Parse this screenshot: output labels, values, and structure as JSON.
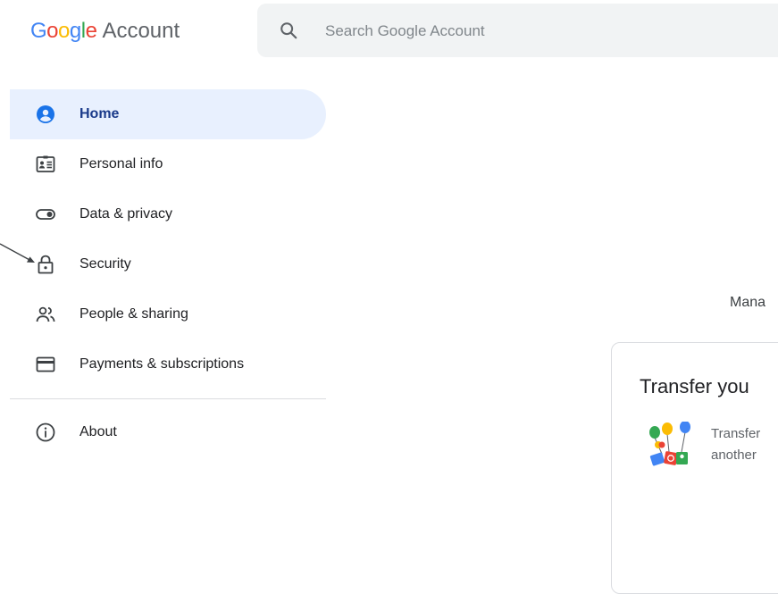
{
  "header": {
    "logo_letters": [
      "G",
      "o",
      "o",
      "g",
      "l",
      "e"
    ],
    "logo_colors": [
      "#4285F4",
      "#EA4335",
      "#FBBC05",
      "#4285F4",
      "#34A853",
      "#EA4335"
    ],
    "product": "Account",
    "search_placeholder": "Search Google Account",
    "search_icon": "search-icon"
  },
  "nav": {
    "active_color": "#e8f0fe",
    "items": [
      {
        "label": "Home",
        "icon": "account-circle-icon",
        "active": true
      },
      {
        "label": "Personal info",
        "icon": "id-card-icon"
      },
      {
        "label": "Data & privacy",
        "icon": "toggle-icon"
      },
      {
        "label": "Security",
        "icon": "lock-icon"
      },
      {
        "label": "People & sharing",
        "icon": "people-icon"
      },
      {
        "label": "Payments & subscriptions",
        "icon": "credit-card-icon"
      },
      {
        "label": "About",
        "icon": "info-icon"
      }
    ]
  },
  "main": {
    "manage_text": "Mana",
    "card": {
      "title": "Transfer you",
      "line1": "Transfer",
      "line2": "another"
    }
  }
}
